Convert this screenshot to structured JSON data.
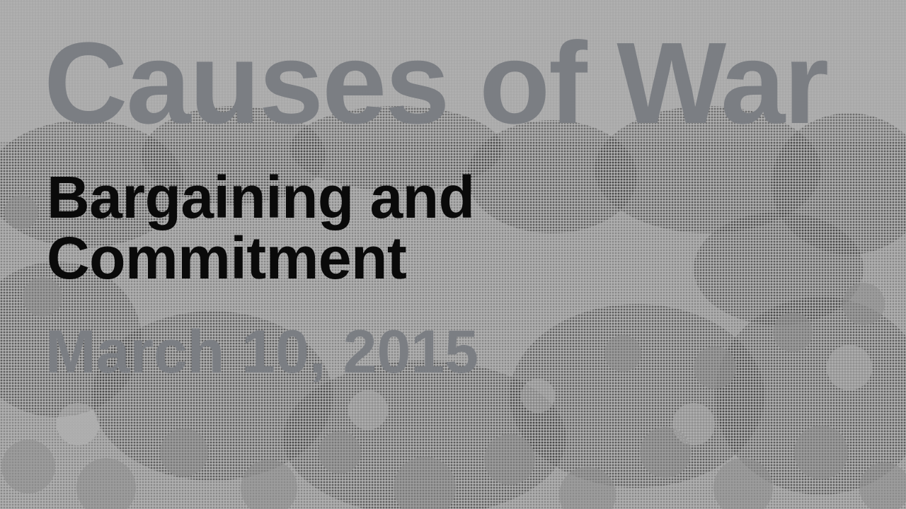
{
  "slide": {
    "title": "Causes of War",
    "subtitle_line1": "Bargaining and",
    "subtitle_line2": "Commitment",
    "date": "March 10, 2015"
  },
  "colors": {
    "title_gray": "#7b7e83",
    "subtitle_black": "#0a0a0a",
    "background_gray": "#b3b3b3"
  },
  "background": {
    "icon": "halftone-crowd-photo"
  }
}
